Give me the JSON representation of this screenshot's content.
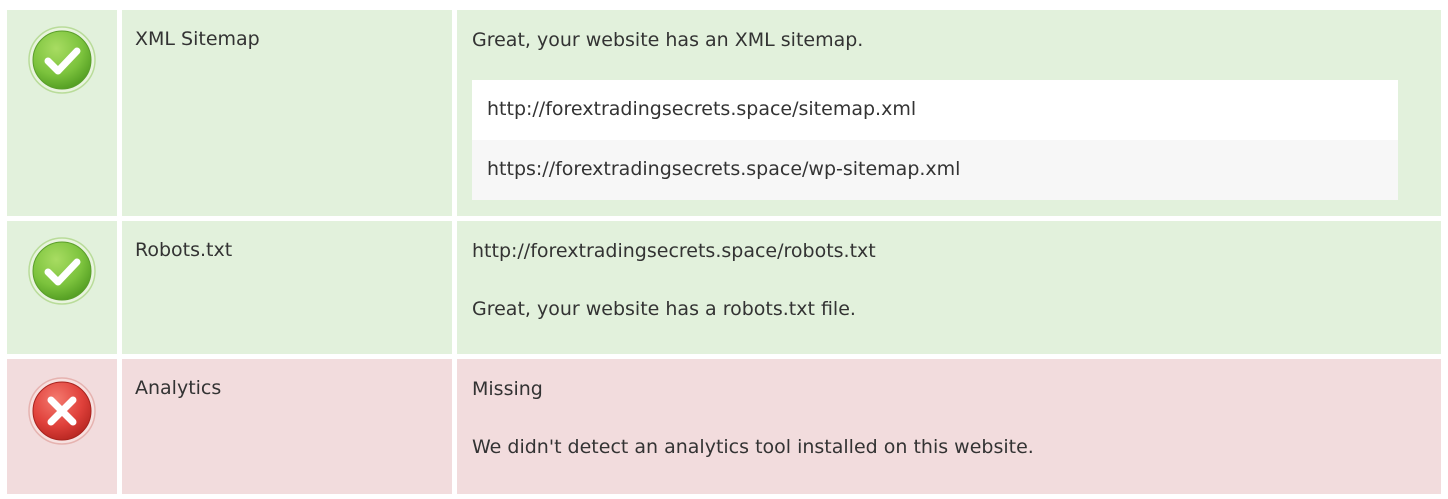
{
  "rows": [
    {
      "status": "pass",
      "icon": "check-circle-icon",
      "name": "XML Sitemap",
      "message": "Great, your website has an XML sitemap.",
      "items": [
        "http://forextradingsecrets.space/sitemap.xml",
        "https://forextradingsecrets.space/wp-sitemap.xml"
      ]
    },
    {
      "status": "pass",
      "icon": "check-circle-icon",
      "name": "Robots.txt",
      "lines": [
        "http://forextradingsecrets.space/robots.txt",
        "Great, your website has a robots.txt file."
      ]
    },
    {
      "status": "fail",
      "icon": "x-circle-icon",
      "name": "Analytics",
      "lines": [
        "Missing",
        "We didn't detect an analytics tool installed on this website."
      ]
    }
  ],
  "colors": {
    "pass_bg": "#e2f1dc",
    "fail_bg": "#f2dcdd",
    "pass_icon": "#7cc33d",
    "fail_icon": "#e0413b"
  }
}
